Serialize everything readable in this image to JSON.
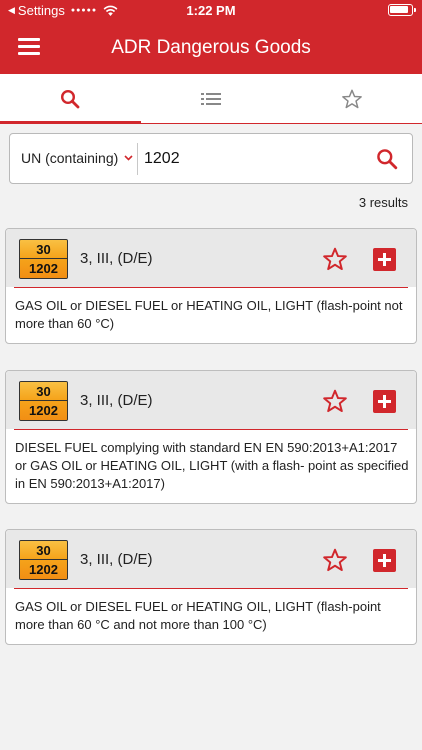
{
  "status_bar": {
    "back_app": "Settings",
    "time": "1:22 PM"
  },
  "header": {
    "title": "ADR Dangerous Goods"
  },
  "tabs": [
    {
      "id": "search",
      "icon": "search-icon",
      "active": true
    },
    {
      "id": "list",
      "icon": "list-icon",
      "active": false
    },
    {
      "id": "favorites",
      "icon": "star-icon",
      "active": false
    }
  ],
  "search": {
    "type_label": "UN (containing)",
    "value": "1202"
  },
  "results_count": "3 results",
  "results": [
    {
      "hazard_number": "30",
      "un_number": "1202",
      "classification": "3, III, (D/E)",
      "description": "GAS OIL or DIESEL FUEL or HEATING OIL, LIGHT (flash-point not more than 60 °C)"
    },
    {
      "hazard_number": "30",
      "un_number": "1202",
      "classification": "3, III, (D/E)",
      "description": "DIESEL FUEL complying with standard EN EN 590:2013+A1:2017 or GAS OIL or HEATING OIL, LIGHT (with a flash- point as specified in EN 590:2013+A1:2017)"
    },
    {
      "hazard_number": "30",
      "un_number": "1202",
      "classification": "3, III, (D/E)",
      "description": "GAS OIL or DIESEL FUEL or HEATING OIL, LIGHT (flash-point more than 60 °C and not more than 100 °C)"
    }
  ],
  "colors": {
    "accent": "#d1272c",
    "plate_orange": "#f5a31a",
    "background": "#f2f2f2"
  }
}
